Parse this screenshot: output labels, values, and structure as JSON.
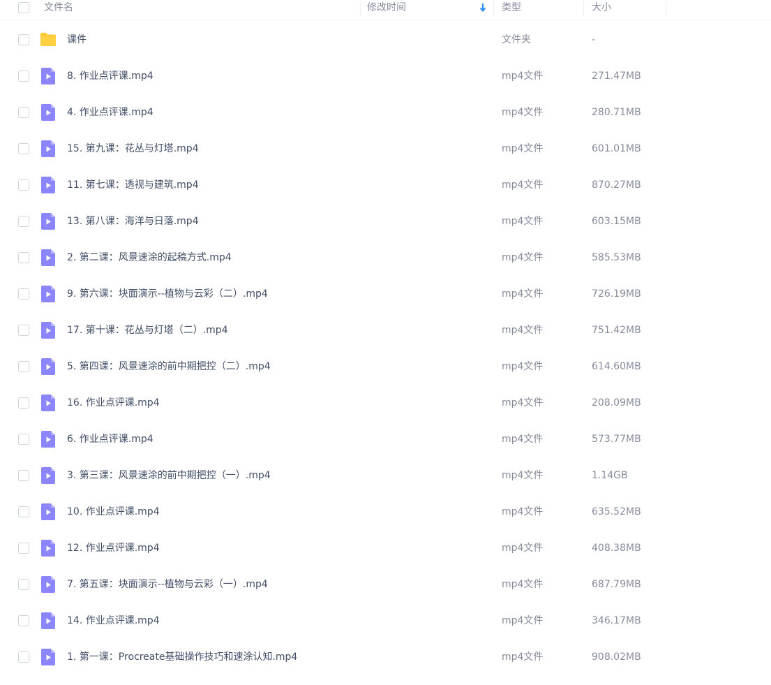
{
  "header": {
    "name": "文件名",
    "modified": "修改时间",
    "type": "类型",
    "size": "大小",
    "sort_icon": "arrow-down-icon",
    "sort_color": "#2b8af7"
  },
  "icons": {
    "folder": "folder-icon",
    "video": "video-file-icon",
    "folder_color": "#ffc933",
    "video_color": "#8b85ff"
  },
  "rows": [
    {
      "kind": "folder",
      "name": "课件",
      "type": "文件夹",
      "size": "-"
    },
    {
      "kind": "video",
      "name": "8. 作业点评课.mp4",
      "type": "mp4文件",
      "size": "271.47MB"
    },
    {
      "kind": "video",
      "name": "4. 作业点评课.mp4",
      "type": "mp4文件",
      "size": "280.71MB"
    },
    {
      "kind": "video",
      "name": "15. 第九课：花丛与灯塔.mp4",
      "type": "mp4文件",
      "size": "601.01MB"
    },
    {
      "kind": "video",
      "name": "11. 第七课：透视与建筑.mp4",
      "type": "mp4文件",
      "size": "870.27MB"
    },
    {
      "kind": "video",
      "name": "13. 第八课：海洋与日落.mp4",
      "type": "mp4文件",
      "size": "603.15MB"
    },
    {
      "kind": "video",
      "name": "2. 第二课：风景速涂的起稿方式.mp4",
      "type": "mp4文件",
      "size": "585.53MB"
    },
    {
      "kind": "video",
      "name": "9. 第六课：块面演示--植物与云彩（二）.mp4",
      "type": "mp4文件",
      "size": "726.19MB"
    },
    {
      "kind": "video",
      "name": "17. 第十课：花丛与灯塔（二）.mp4",
      "type": "mp4文件",
      "size": "751.42MB"
    },
    {
      "kind": "video",
      "name": "5. 第四课：风景速涂的前中期把控（二）.mp4",
      "type": "mp4文件",
      "size": "614.60MB"
    },
    {
      "kind": "video",
      "name": "16. 作业点评课.mp4",
      "type": "mp4文件",
      "size": "208.09MB"
    },
    {
      "kind": "video",
      "name": "6. 作业点评课.mp4",
      "type": "mp4文件",
      "size": "573.77MB"
    },
    {
      "kind": "video",
      "name": "3. 第三课：风景速涂的前中期把控（一）.mp4",
      "type": "mp4文件",
      "size": "1.14GB"
    },
    {
      "kind": "video",
      "name": "10. 作业点评课.mp4",
      "type": "mp4文件",
      "size": "635.52MB"
    },
    {
      "kind": "video",
      "name": "12. 作业点评课.mp4",
      "type": "mp4文件",
      "size": "408.38MB"
    },
    {
      "kind": "video",
      "name": "7. 第五课：块面演示--植物与云彩（一）.mp4",
      "type": "mp4文件",
      "size": "687.79MB"
    },
    {
      "kind": "video",
      "name": "14. 作业点评课.mp4",
      "type": "mp4文件",
      "size": "346.17MB"
    },
    {
      "kind": "video",
      "name": "1. 第一课：Procreate基础操作技巧和速涂认知.mp4",
      "type": "mp4文件",
      "size": "908.02MB"
    }
  ]
}
